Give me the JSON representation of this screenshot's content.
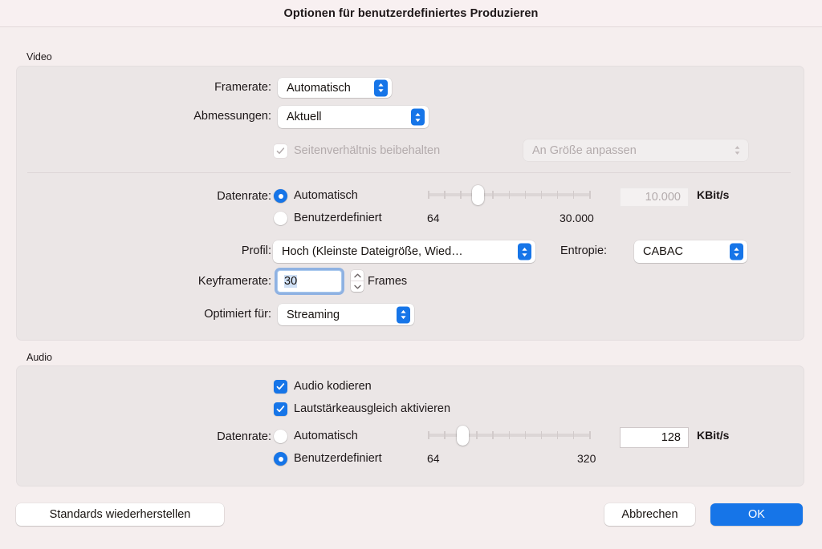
{
  "window": {
    "title": "Optionen für benutzerdefiniertes Produzieren"
  },
  "video": {
    "group_label": "Video",
    "framerate": {
      "label": "Framerate:",
      "value": "Automatisch"
    },
    "dimensions": {
      "label": "Abmessungen:",
      "value": "Aktuell"
    },
    "aspect": {
      "checkbox_label": "Seitenverhältnis beibehalten",
      "checked": true,
      "enabled": false,
      "popup_value": "An Größe anpassen"
    },
    "datarate": {
      "label": "Datenrate:",
      "option_auto": "Automatisch",
      "option_custom": "Benutzerdefiniert",
      "selected": "Automatisch",
      "slider_min_label": "64",
      "slider_max_label": "30.000",
      "slider_position_pct": 29,
      "slider_ticks": 11,
      "value": "10.000",
      "value_enabled": false,
      "unit": "KBit/s"
    },
    "profile": {
      "label": "Profil:",
      "value": "Hoch (Kleinste Dateigröße, Wied…"
    },
    "entropy": {
      "label": "Entropie:",
      "value": "CABAC"
    },
    "keyframerate": {
      "label": "Keyframerate:",
      "value": "30",
      "unit": "Frames",
      "focused": true
    },
    "optimized_for": {
      "label": "Optimiert für:",
      "value": "Streaming"
    }
  },
  "audio": {
    "group_label": "Audio",
    "encode": {
      "label": "Audio kodieren",
      "checked": true
    },
    "normalize": {
      "label": "Lautstärkeausgleich aktivieren",
      "checked": true
    },
    "datarate": {
      "label": "Datenrate:",
      "option_auto": "Automatisch",
      "option_custom": "Benutzerdefiniert",
      "selected": "Benutzerdefiniert",
      "slider_min_label": "64",
      "slider_max_label": "320",
      "slider_position_pct": 19,
      "slider_ticks": 11,
      "value": "128",
      "value_enabled": true,
      "unit": "KBit/s"
    }
  },
  "footer": {
    "restore_defaults": "Standards wiederherstellen",
    "cancel": "Abbrechen",
    "ok": "OK"
  },
  "colors": {
    "accent": "#1675e8",
    "window_bg": "#f5eeee",
    "group_bg": "#ebe6e6",
    "titlebar_bg": "#f8f0f1"
  }
}
